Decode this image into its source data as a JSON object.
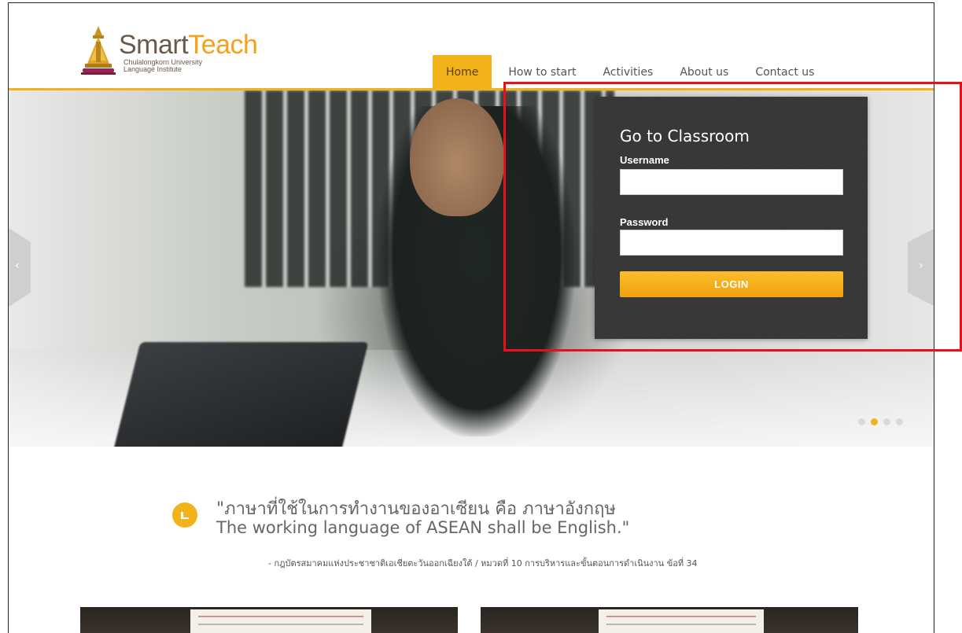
{
  "brand": {
    "name_part1": "Smart",
    "name_part2": "Teach",
    "sub_line1": "Chulalongkorn University",
    "sub_line2": "Language Institute",
    "accent_color": "#f2b31a"
  },
  "nav": {
    "items": [
      {
        "label": "Home",
        "active": true
      },
      {
        "label": "How to start",
        "active": false
      },
      {
        "label": "Activities",
        "active": false
      },
      {
        "label": "About us",
        "active": false
      },
      {
        "label": "Contact us",
        "active": false
      }
    ]
  },
  "slider": {
    "prev_icon": "chevron-left-icon",
    "next_icon": "chevron-right-icon",
    "prev_glyph": "‹",
    "next_glyph": "›",
    "slide_count": 4,
    "active_slide": 2
  },
  "login": {
    "title": "Go to Classroom",
    "username_label": "Username",
    "username_value": "",
    "password_label": "Password",
    "password_value": "",
    "button_label": "LOGIN"
  },
  "quote": {
    "icon": "quote-icon",
    "line1": "\"ภาษาที่ใช้ในการทำงานของอาเซียน คือ ภาษาอังกฤษ",
    "line2": "The working language of ASEAN shall be English.\"",
    "source": "- กฎบัตรสมาคมแห่งประชาชาติเอเชียตะวันออกเฉียงใต้ / หมวดที่ 10 การบริหารและขั้นตอนการดำเนินงาน ข้อที่ 34"
  },
  "highlight_color": "#e8111b"
}
